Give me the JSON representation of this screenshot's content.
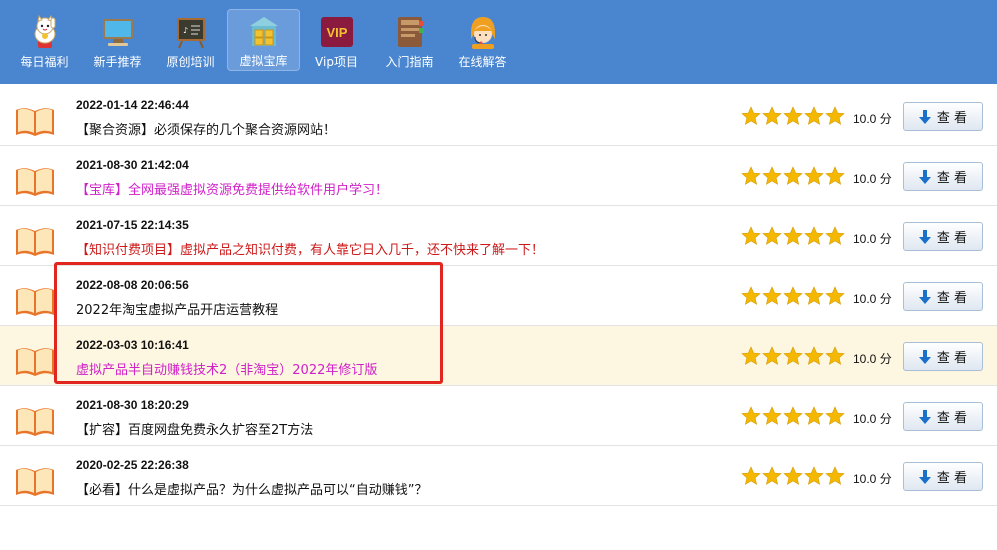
{
  "nav": {
    "items": [
      {
        "label": "每日福利",
        "icon": "lucky-cat-icon"
      },
      {
        "label": "新手推荐",
        "icon": "monitor-icon"
      },
      {
        "label": "原创培训",
        "icon": "chalkboard-icon"
      },
      {
        "label": "虚拟宝库",
        "icon": "treasure-house-icon",
        "active": true
      },
      {
        "label": "Vip项目",
        "icon": "vip-badge-icon",
        "badge": "VIP"
      },
      {
        "label": "入门指南",
        "icon": "guidebook-icon"
      },
      {
        "label": "在线解答",
        "icon": "customer-service-icon"
      }
    ]
  },
  "articles": [
    {
      "date": "2022-01-14 22:46:44",
      "title": "【聚合资源】必须保存的几个聚合资源网站！",
      "color": "#111111",
      "score": "10.0 分",
      "button": "查 看",
      "rating": 5
    },
    {
      "date": "2021-08-30 21:42:04",
      "title": "【宝库】全网最强虚拟资源免费提供给软件用户学习！",
      "color": "#d020c8",
      "score": "10.0 分",
      "button": "查 看",
      "rating": 5
    },
    {
      "date": "2021-07-15 22:14:35",
      "title": "【知识付费项目】虚拟产品之知识付费，有人靠它日入几千，还不快来了解一下！",
      "color": "#cc1a1a",
      "score": "10.0 分",
      "button": "查 看",
      "rating": 5
    },
    {
      "date": "2022-08-08 20:06:56",
      "title": "2022年淘宝虚拟产品开店运营教程",
      "color": "#111111",
      "score": "10.0 分",
      "button": "查 看",
      "rating": 5
    },
    {
      "date": "2022-03-03 10:16:41",
      "title": "虚拟产品半自动赚钱技术2（非淘宝）2022年修订版",
      "color": "#d020c8",
      "score": "10.0 分",
      "button": "查 看",
      "rating": 5,
      "highlighted": true
    },
    {
      "date": "2021-08-30 18:20:29",
      "title": "【扩容】百度网盘免费永久扩容至2T方法",
      "color": "#111111",
      "score": "10.0 分",
      "button": "查 看",
      "rating": 5
    },
    {
      "date": "2020-02-25 22:26:38",
      "title": "【必看】什么是虚拟产品？为什么虚拟产品可以“自动赚钱”？",
      "color": "#111111",
      "score": "10.0 分",
      "button": "查 看",
      "rating": 5
    }
  ],
  "colors": {
    "nav_bg": "#4a86cf",
    "star": "#f5b800",
    "highlight_row": "#fdf6e0",
    "annotation_box": "#e0261e"
  }
}
